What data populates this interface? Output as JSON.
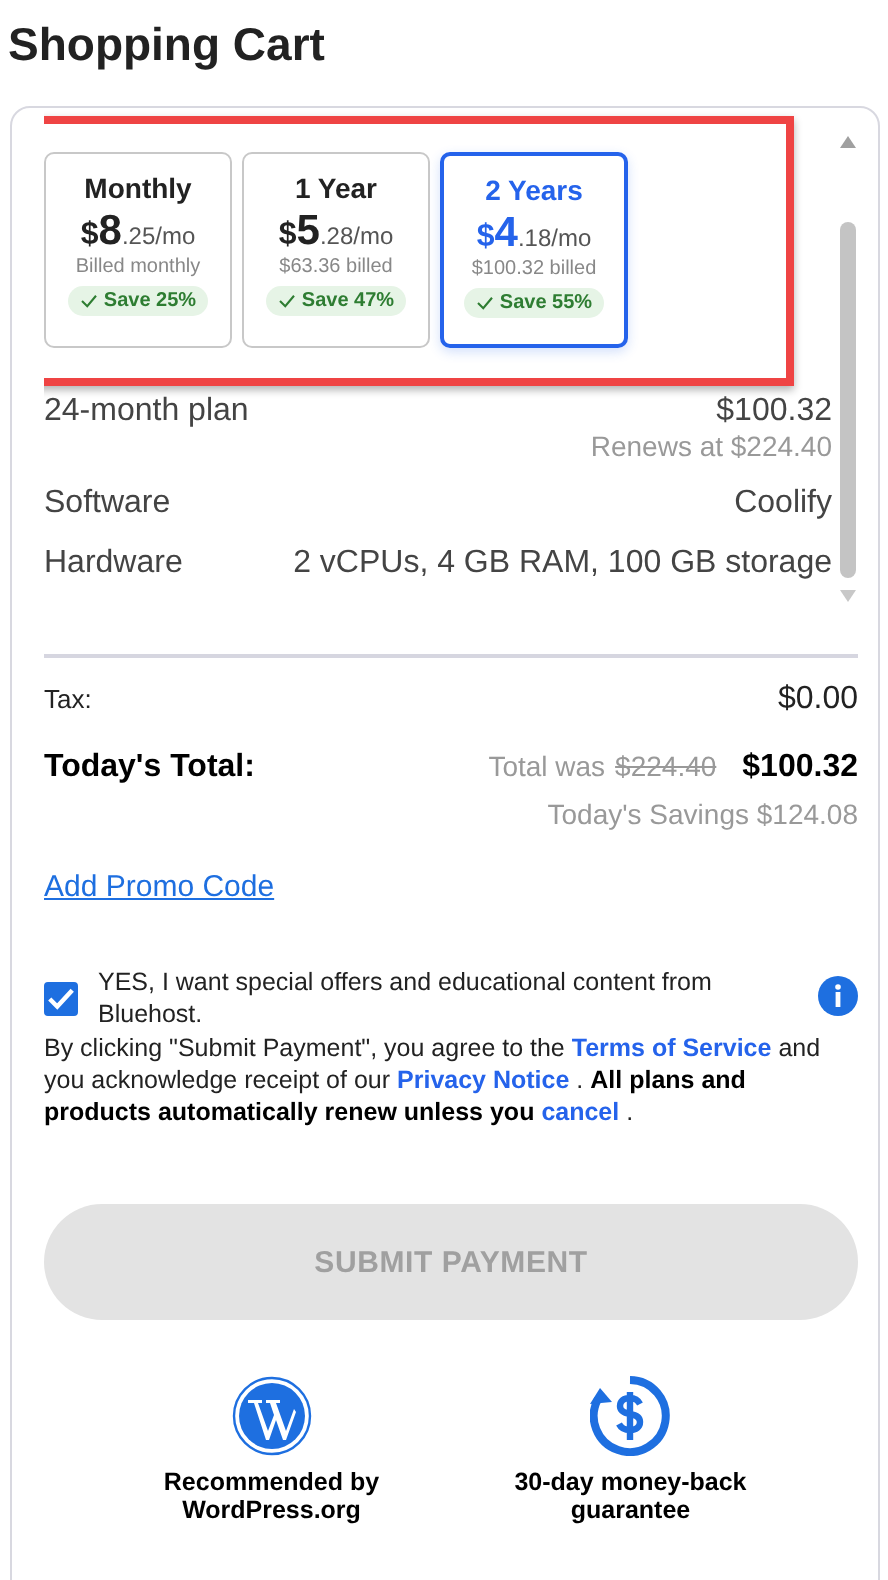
{
  "title": "Shopping Cart",
  "plans": [
    {
      "name": "Monthly",
      "currency": "$",
      "whole": "8",
      "rest": ".25/mo",
      "billed": "Billed monthly",
      "save": "Save 25%",
      "selected": false
    },
    {
      "name": "1 Year",
      "currency": "$",
      "whole": "5",
      "rest": ".28/mo",
      "billed": "$63.36 billed",
      "save": "Save 47%",
      "selected": false
    },
    {
      "name": "2 Years",
      "currency": "$",
      "whole": "4",
      "rest": ".18/mo",
      "billed": "$100.32 billed",
      "save": "Save 55%",
      "selected": true
    }
  ],
  "plan_line": {
    "label": "24-month plan",
    "price": "$100.32",
    "renews": "Renews at $224.40"
  },
  "specs": [
    {
      "label": "Software",
      "value": "Coolify"
    },
    {
      "label": "Hardware",
      "value": "2 vCPUs, 4 GB RAM, 100 GB storage"
    }
  ],
  "tax": {
    "label": "Tax:",
    "value": "$0.00"
  },
  "total": {
    "label": "Today's Total:",
    "was_label": "Total was",
    "was_amount": "$224.40",
    "amount": "$100.32",
    "savings": "Today's Savings $124.08"
  },
  "promo_link": "Add Promo Code",
  "offers": {
    "checked": true,
    "text": "YES, I want special offers and educational content from Bluehost."
  },
  "legal": [
    {
      "kind": "text",
      "text": "By clicking \"Submit Payment\", you agree to the"
    },
    {
      "kind": "link",
      "text": "Terms of Service"
    },
    {
      "kind": "text",
      "text": "and you acknowledge receipt of our"
    },
    {
      "kind": "link",
      "text": "Privacy Notice"
    },
    {
      "kind": "text",
      "text": "."
    },
    {
      "kind": "bold",
      "text": "All plans and products automatically renew unless you"
    },
    {
      "kind": "link",
      "text": "cancel"
    },
    {
      "kind": "text",
      "text": "."
    }
  ],
  "submit": {
    "label": "SUBMIT PAYMENT",
    "disabled": true
  },
  "badges": [
    {
      "kind": "wordpress",
      "text": "Recommended by WordPress.org"
    },
    {
      "kind": "moneyback",
      "text": "30-day money-back guarantee"
    }
  ]
}
